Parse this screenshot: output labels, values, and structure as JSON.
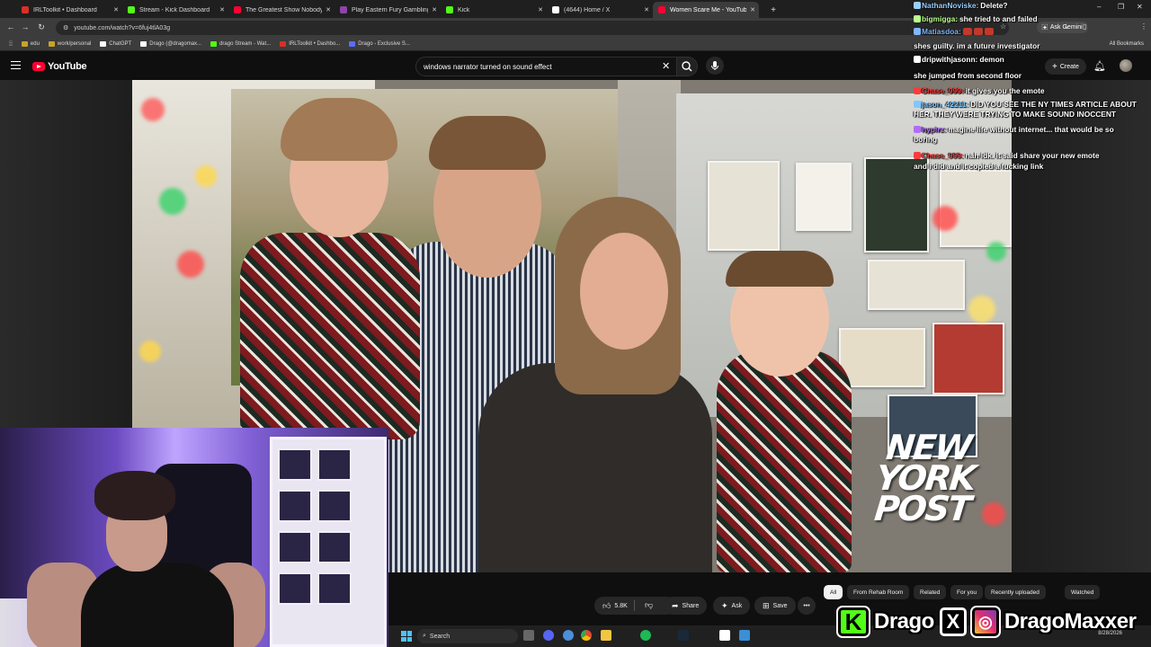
{
  "browser": {
    "tabs": [
      {
        "label": "IRLToolkit • Dashboard",
        "color": "#d93025",
        "active": false
      },
      {
        "label": "Stream - Kick Dashboard",
        "color": "#53fc18",
        "active": false
      },
      {
        "label": "The Greatest Show Nobody Is W",
        "color": "#ff0033",
        "active": false
      },
      {
        "label": "Play Eastern Fury Gambling Ga",
        "color": "#8e44ad",
        "active": false
      },
      {
        "label": "Kick",
        "color": "#53fc18",
        "active": false
      },
      {
        "label": "(4644) Home / X",
        "color": "#ffffff",
        "active": false
      },
      {
        "label": "Women Scare Me - YouTube",
        "color": "#ff0033",
        "active": true
      }
    ],
    "url": "youtube.com/watch?v=6fuj4tlA03g",
    "ask_gemini": "Ask Gemini",
    "bookmarks": [
      {
        "label": "edu",
        "color": "#c9a227"
      },
      {
        "label": "work/personal",
        "color": "#c9a227"
      },
      {
        "label": "ChatGPT",
        "color": "#ffffff"
      },
      {
        "label": "Drago (@dragomax...",
        "color": "#ffffff"
      },
      {
        "label": "drago Stream - Wat...",
        "color": "#53fc18"
      },
      {
        "label": "IRLToolkit • Dashbo...",
        "color": "#d93025"
      },
      {
        "label": "Drago - Exclusive S...",
        "color": "#5b6cff"
      }
    ],
    "all_bookmarks": "All Bookmarks"
  },
  "youtube": {
    "logo_text": "YouTube",
    "search_query": "windows narrator turned on sound effect",
    "create_label": "Create",
    "video_watermark": "NEW YORK POST",
    "actions": {
      "likes": "5.8K",
      "share": "Share",
      "ask": "Ask",
      "save": "Save"
    },
    "chips": [
      "All",
      "From Rehab Room",
      "Related",
      "For you",
      "Recently uploaded",
      "Watched"
    ]
  },
  "chat": [
    {
      "user": "NathanNoviske:",
      "message": "Delete?",
      "color": "#9ad0ff"
    },
    {
      "user": "bigmigga:",
      "message": "she tried to and failed",
      "color": "#b8ff8a"
    },
    {
      "user": "Matiasdoa:",
      "message": "",
      "color": "#7fb8ff"
    },
    {
      "user": "",
      "message": "shes guilty. im a future investigator",
      "color": "#ff5a5a"
    },
    {
      "user": "dripwithjasonn:",
      "message": "demon",
      "color": "#ffffff"
    },
    {
      "user": "",
      "message": "she jumped from second floor",
      "color": "#ff3b3b"
    },
    {
      "user": "Chase_999:",
      "message": "it gives you the emote",
      "color": "#ff3b3b"
    },
    {
      "user": "jason_42211:",
      "message": "DID YOU SEE THE NY TIMES ARTICLE ABOUT",
      "color": "#7ec8ff"
    },
    {
      "user": "",
      "message": "HER. THEY WERE TRYING TO MAKE SOUND INOCCENT",
      "color": "#ffffff"
    },
    {
      "user": "hypirz:",
      "message": "magine life without internet... that would be so",
      "color": "#b36bff"
    },
    {
      "user": "",
      "message": "boring",
      "color": "#ffffff"
    },
    {
      "user": "Chase_999:",
      "message": "nah idk. it said share your new emote",
      "color": "#ff3b3b"
    },
    {
      "user": "",
      "message": "and i did and it copied a fucking link",
      "color": "#ffffff"
    }
  ],
  "taskbar": {
    "search_label": "Search",
    "time": "",
    "date": "8/28/2026"
  },
  "banner": {
    "kick_letter": "K",
    "name": "Drago",
    "x_letter": "X",
    "ig_handle": "DragoMaxxer"
  }
}
